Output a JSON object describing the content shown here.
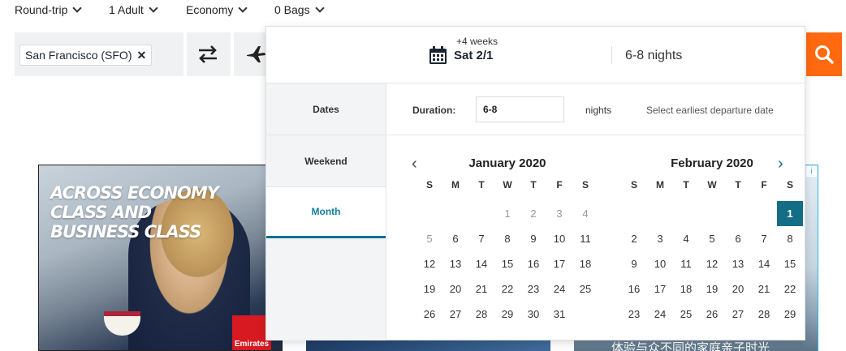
{
  "options": {
    "trip_type": "Round-trip",
    "passengers": "1 Adult",
    "cabin": "Economy",
    "bags": "0 Bags"
  },
  "search": {
    "origin": "San Francisco (SFO)",
    "remove_symbol": "✕"
  },
  "picker": {
    "plus_weeks": "+4 weeks",
    "selected_date": "Sat 2/1",
    "nights_summary": "6-8 nights",
    "tabs": [
      "Dates",
      "Weekend",
      "Month"
    ],
    "active_tab": "Month",
    "duration_label": "Duration:",
    "duration_value": "6-8",
    "duration_unit": "nights",
    "hint": "Select earliest departure date",
    "nav_prev": "‹",
    "nav_next": "›",
    "weekdays": [
      "S",
      "M",
      "T",
      "W",
      "T",
      "F",
      "S"
    ],
    "months": [
      {
        "title": "January 2020",
        "weeks": [
          [
            "",
            "",
            "",
            "1",
            "2",
            "3",
            "4"
          ],
          [
            "5",
            "6",
            "7",
            "8",
            "9",
            "10",
            "11"
          ],
          [
            "12",
            "13",
            "14",
            "15",
            "16",
            "17",
            "18"
          ],
          [
            "19",
            "20",
            "21",
            "22",
            "23",
            "24",
            "25"
          ],
          [
            "26",
            "27",
            "28",
            "29",
            "30",
            "31",
            ""
          ]
        ],
        "dim_days": [
          "1",
          "2",
          "3",
          "4",
          "5"
        ]
      },
      {
        "title": "February 2020",
        "weeks": [
          [
            "",
            "",
            "",
            "",
            "",
            "",
            "1"
          ],
          [
            "2",
            "3",
            "4",
            "5",
            "6",
            "7",
            "8"
          ],
          [
            "9",
            "10",
            "11",
            "12",
            "13",
            "14",
            "15"
          ],
          [
            "16",
            "17",
            "18",
            "19",
            "20",
            "21",
            "22"
          ],
          [
            "23",
            "24",
            "25",
            "26",
            "27",
            "28",
            "29"
          ]
        ],
        "selected_day": "1"
      }
    ]
  },
  "ads": {
    "headline_line1": "ACROSS ECONOMY CLASS AND",
    "headline_line2": "BUSINESS CLASS",
    "brand": "Emirates",
    "cjk_text": "体验与众不同的家庭亲子时光",
    "info_glyph": "i"
  },
  "colors": {
    "accent": "#146d86",
    "search_button": "#ff690f"
  }
}
